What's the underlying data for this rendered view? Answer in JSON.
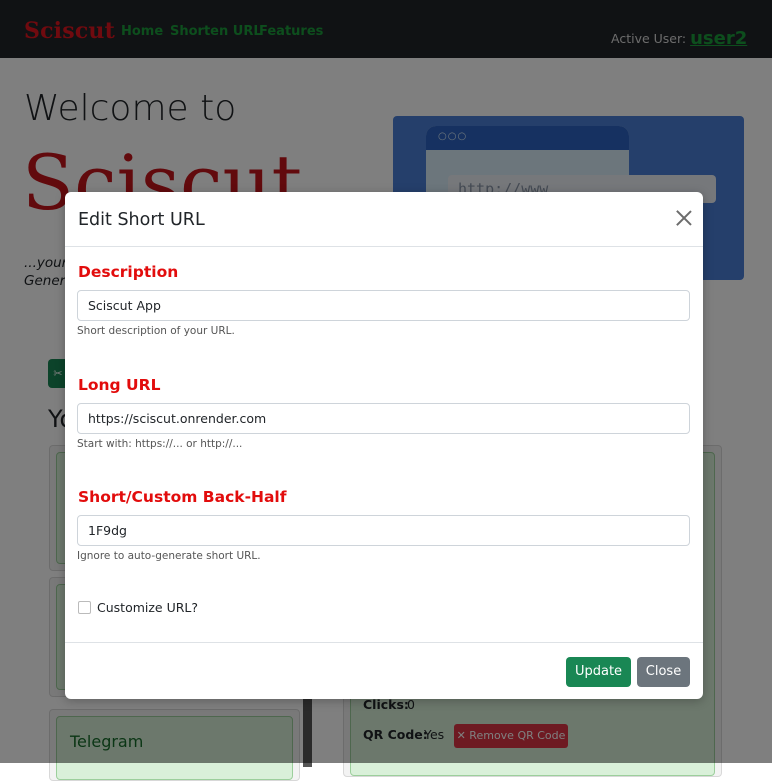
{
  "navbar": {
    "brand": "Sciscut",
    "links": [
      "Home",
      "Shorten URL",
      "Features"
    ],
    "active_user_label": "Active User:",
    "username": "user2"
  },
  "hero": {
    "welcome": "Welcome to",
    "name": "Sciscut",
    "tagline_line1": "...your",
    "tagline_line2": "Gener",
    "url_text": "http://www"
  },
  "page": {
    "your_heading": "Yo",
    "shorten_button_icon": "scissors-icon"
  },
  "cards": [
    {
      "title": ""
    },
    {
      "title": ""
    },
    {
      "title": "Telegram"
    }
  ],
  "detail": {
    "clicks_label": "Clicks:",
    "clicks_value": "0",
    "qr_label": "QR Code:",
    "qr_value": "Yes",
    "remove_qr": "✕ Remove QR Code"
  },
  "modal": {
    "title": "Edit Short URL",
    "description_label": "Description",
    "description_value": "Sciscut App",
    "description_help": "Short description of your URL.",
    "long_url_label": "Long URL",
    "long_url_value": "https://sciscut.onrender.com",
    "long_url_help": "Start with: https://... or http://...",
    "backhalf_label": "Short/Custom Back-Half",
    "backhalf_value": "1F9dg",
    "backhalf_help": "Ignore to auto-generate short URL.",
    "customize_label": "Customize URL?",
    "customize_checked": false,
    "update_button": "Update",
    "close_button": "Close"
  },
  "colors": {
    "brand_red": "#e0141e",
    "nav_green": "#1a9c3a",
    "label_red": "#e20c0c",
    "update_green": "#198754",
    "close_gray": "#6c757d"
  }
}
